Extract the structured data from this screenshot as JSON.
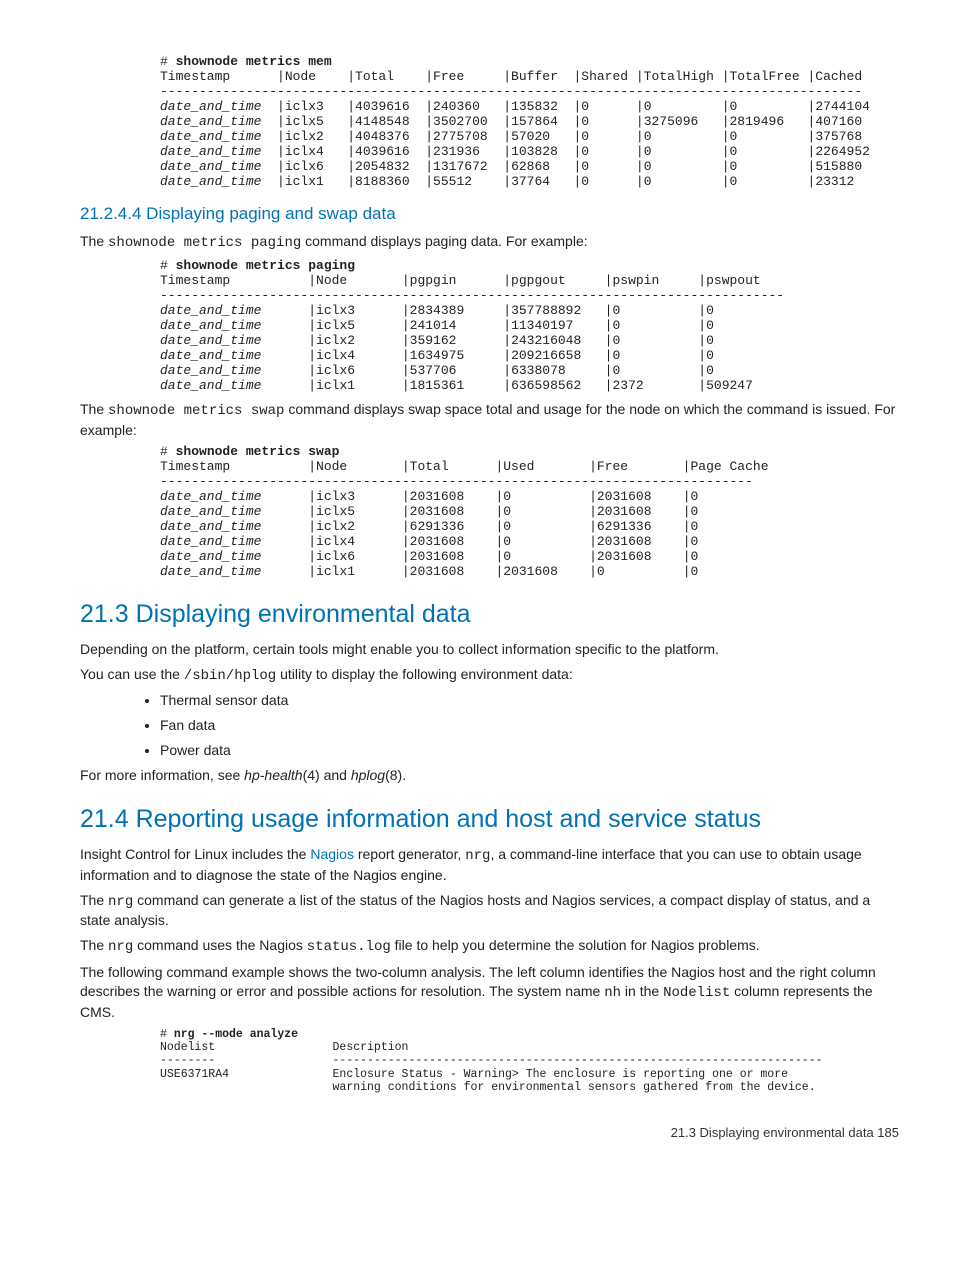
{
  "mem": {
    "cmd_prefix": "# ",
    "cmd": "shownode metrics mem",
    "headers": [
      "Timestamp",
      "Node",
      "Total",
      "Free",
      "Buffer",
      "Shared",
      "TotalHigh",
      "TotalFree",
      "Cached"
    ],
    "hr": "------------------------------------------------------------------------------------------",
    "rows": [
      {
        "ts": "date_and_time",
        "node": "iclx3",
        "total": "4039616",
        "free": "240360",
        "buffer": "135832",
        "shared": "0",
        "th": "0",
        "tf": "0",
        "cached": "2744104"
      },
      {
        "ts": "date_and_time",
        "node": "iclx5",
        "total": "4148548",
        "free": "3502700",
        "buffer": "157864",
        "shared": "0",
        "th": "3275096",
        "tf": "2819496",
        "cached": "407160"
      },
      {
        "ts": "date_and_time",
        "node": "iclx2",
        "total": "4048376",
        "free": "2775708",
        "buffer": "57020",
        "shared": "0",
        "th": "0",
        "tf": "0",
        "cached": "375768"
      },
      {
        "ts": "date_and_time",
        "node": "iclx4",
        "total": "4039616",
        "free": "231936",
        "buffer": "103828",
        "shared": "0",
        "th": "0",
        "tf": "0",
        "cached": "2264952"
      },
      {
        "ts": "date_and_time",
        "node": "iclx6",
        "total": "2054832",
        "free": "1317672",
        "buffer": "62868",
        "shared": "0",
        "th": "0",
        "tf": "0",
        "cached": "515880"
      },
      {
        "ts": "date_and_time",
        "node": "iclx1",
        "total": "8188360",
        "free": "55512",
        "buffer": "37764",
        "shared": "0",
        "th": "0",
        "tf": "0",
        "cached": "23312"
      }
    ]
  },
  "h_paging": "21.2.4.4 Displaying paging and swap data",
  "p_paging_intro_a": "The ",
  "p_paging_intro_cmd": "shownode metrics paging",
  "p_paging_intro_b": " command displays paging data. For example:",
  "paging": {
    "cmd_prefix": "# ",
    "cmd": "shownode metrics paging",
    "headers": [
      "Timestamp",
      "Node",
      "pgpgin",
      "pgpgout",
      "pswpin",
      "pswpout"
    ],
    "hr": "--------------------------------------------------------------------------------",
    "rows": [
      {
        "ts": "date_and_time",
        "node": "iclx3",
        "in": "2834389",
        "out": "357788892",
        "swin": "0",
        "swout": "0"
      },
      {
        "ts": "date_and_time",
        "node": "iclx5",
        "in": "241014",
        "out": "11340197",
        "swin": "0",
        "swout": "0"
      },
      {
        "ts": "date_and_time",
        "node": "iclx2",
        "in": "359162",
        "out": "243216048",
        "swin": "0",
        "swout": "0"
      },
      {
        "ts": "date_and_time",
        "node": "iclx4",
        "in": "1634975",
        "out": "209216658",
        "swin": "0",
        "swout": "0"
      },
      {
        "ts": "date_and_time",
        "node": "iclx6",
        "in": "537706",
        "out": "6338078",
        "swin": "0",
        "swout": "0"
      },
      {
        "ts": "date_and_time",
        "node": "iclx1",
        "in": "1815361",
        "out": "636598562",
        "swin": "2372",
        "swout": "509247"
      }
    ]
  },
  "p_swap_intro_a": "The ",
  "p_swap_intro_cmd": "shownode metrics swap",
  "p_swap_intro_b": " command displays swap space total and usage for the node on which the command is issued. For example:",
  "swap": {
    "cmd_prefix": "# ",
    "cmd": "shownode metrics swap",
    "headers": [
      "Timestamp",
      "Node",
      "Total",
      "Used",
      "Free",
      "Page Cache"
    ],
    "hr": "----------------------------------------------------------------------------",
    "rows": [
      {
        "ts": "date_and_time",
        "node": "iclx3",
        "total": "2031608",
        "used": "0",
        "free": "2031608",
        "pc": "0"
      },
      {
        "ts": "date_and_time",
        "node": "iclx5",
        "total": "2031608",
        "used": "0",
        "free": "2031608",
        "pc": "0"
      },
      {
        "ts": "date_and_time",
        "node": "iclx2",
        "total": "6291336",
        "used": "0",
        "free": "6291336",
        "pc": "0"
      },
      {
        "ts": "date_and_time",
        "node": "iclx4",
        "total": "2031608",
        "used": "0",
        "free": "2031608",
        "pc": "0"
      },
      {
        "ts": "date_and_time",
        "node": "iclx6",
        "total": "2031608",
        "used": "0",
        "free": "2031608",
        "pc": "0"
      },
      {
        "ts": "date_and_time",
        "node": "iclx1",
        "total": "2031608",
        "used": "2031608",
        "free": "0",
        "pc": "0"
      }
    ]
  },
  "h_213": "21.3 Displaying environmental data",
  "p_213_a": "Depending on the platform, certain tools might enable you to collect information specific to the platform.",
  "p_213_b_a": "You can use the ",
  "p_213_b_cmd": "/sbin/hplog",
  "p_213_b_b": " utility to display the following environment data:",
  "bullets": [
    "Thermal sensor data",
    "Fan data",
    "Power data"
  ],
  "p_213_c_a": "For more information, see ",
  "p_213_c_i1": "hp-health",
  "p_213_c_m1": "(4) and ",
  "p_213_c_i2": "hplog",
  "p_213_c_m2": "(8).",
  "h_214": "21.4 Reporting usage information and host and service status",
  "p_214_a_pre": "Insight Control for Linux includes the ",
  "p_214_a_link": "Nagios",
  "p_214_a_mid": " report generator, ",
  "p_214_a_cmd": "nrg",
  "p_214_a_post": ", a command-line interface that you can use to obtain usage information and to diagnose the state of the Nagios engine.",
  "p_214_b_a": "The ",
  "p_214_b_cmd": "nrg",
  "p_214_b_b": " command can generate a list of the status of the Nagios hosts and Nagios services, a compact display of status, and a state analysis.",
  "p_214_c_a": "The ",
  "p_214_c_cmd1": "nrg",
  "p_214_c_mid": " command uses the Nagios ",
  "p_214_c_cmd2": "status.log",
  "p_214_c_b": " file to help you determine the solution for Nagios problems.",
  "p_214_d_a": "The following command example shows the two-column analysis. The left column identifies the Nagios host and the right column describes the warning or error and possible actions for resolution. The system name ",
  "p_214_d_cmd1": "nh",
  "p_214_d_mid": " in the ",
  "p_214_d_cmd2": "Nodelist",
  "p_214_d_b": " column represents the CMS.",
  "nrg": {
    "cmd_prefix": "# ",
    "cmd": "nrg --mode analyze",
    "h1": "Nodelist",
    "h2": "Description",
    "sep1": "--------",
    "sep2": "-----------------------------------------------------------------------",
    "host": "USE6371RA4",
    "desc1": "Enclosure Status - Warning> The enclosure is reporting one or more",
    "desc2": "warning conditions for environmental sensors gathered from the device."
  },
  "footer": "21.3 Displaying environmental data   185"
}
